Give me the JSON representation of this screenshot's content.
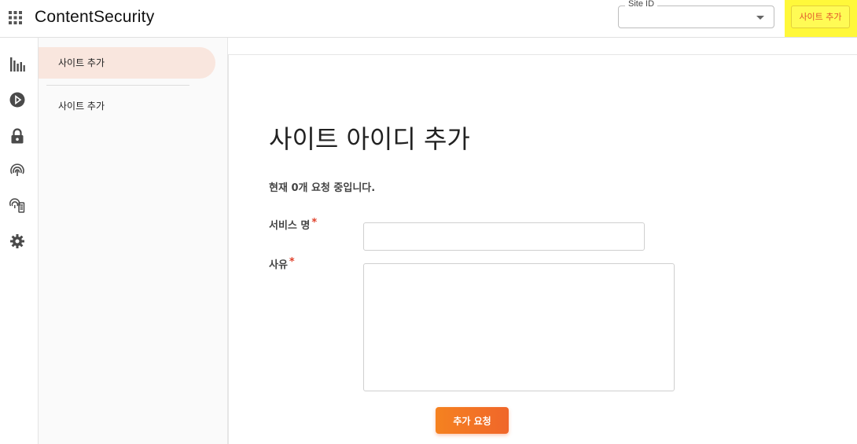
{
  "header": {
    "logo": "ContentSecurity",
    "site_select": {
      "legend": "Site ID",
      "value": ""
    },
    "add_site_label": "사이트 추가",
    "highlight_color": "#fff83a"
  },
  "rail": {
    "icons": [
      "bar-chart-icon",
      "play-circle-icon",
      "lock-icon",
      "fingerprint-icon",
      "fingerprint-document-icon",
      "gear-icon"
    ]
  },
  "submenu": {
    "active_label": "사이트 추가",
    "items": [
      {
        "label": "사이트 추가"
      }
    ]
  },
  "main": {
    "title": "사이트 아이디 추가",
    "status": "현재 0개 요청 중입니다.",
    "service_label": "서비스 명",
    "reason_label": "사유",
    "required_mark": "*",
    "service_value": "",
    "reason_value": "",
    "submit_label": "추가 요청"
  },
  "colors": {
    "accent": "#f0662a",
    "active_bg": "#f9e6de"
  }
}
